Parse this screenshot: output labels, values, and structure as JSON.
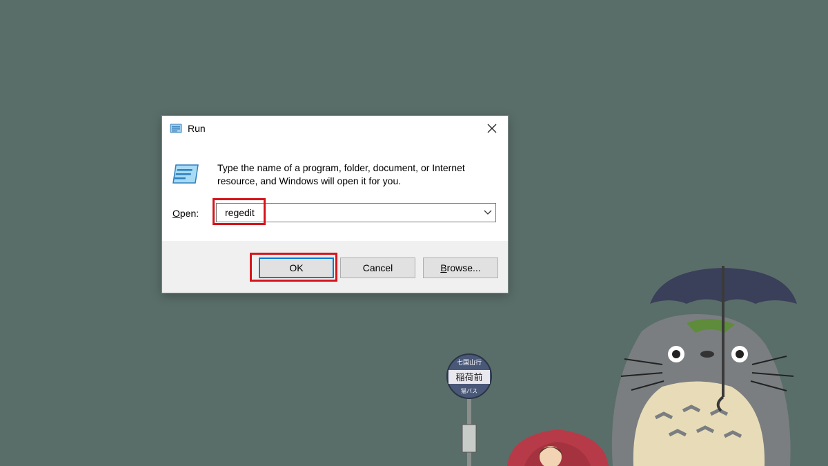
{
  "dialog": {
    "title": "Run",
    "description": "Type the name of a program, folder, document, or Internet resource, and Windows will open it for you.",
    "open_label_underlined": "O",
    "open_label_rest": "pen:",
    "input_value": "regedit",
    "buttons": {
      "ok": "OK",
      "cancel": "Cancel",
      "browse_underlined": "B",
      "browse_rest": "rowse..."
    }
  },
  "wallpaper": {
    "bus_sign_top": "七国山行",
    "bus_sign_main": "稲荷前",
    "bus_sign_bottom": "猫バス"
  },
  "colors": {
    "background": "#5a6e69",
    "highlight": "#d7141c",
    "accent": "#0078d7"
  },
  "icons": {
    "title": "run-app-icon",
    "close": "close-icon",
    "big": "run-app-icon",
    "dropdown": "chevron-down-icon"
  }
}
